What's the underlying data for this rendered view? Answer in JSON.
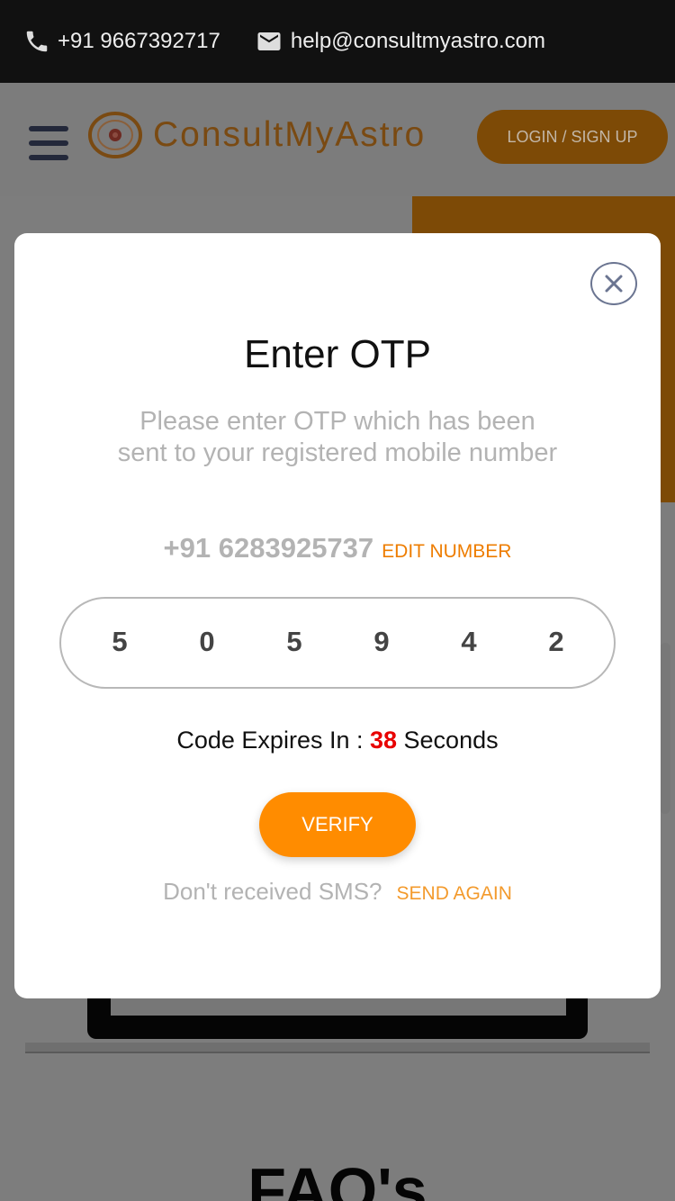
{
  "topbar": {
    "phone": "+91 9667392717",
    "phone_icon": "phone-icon",
    "email": "help@consultmyastro.com",
    "email_icon": "mail-icon"
  },
  "header": {
    "menu_icon": "hamburger-menu-icon",
    "logo_icon": "astro-logo-icon",
    "brand": "ConsultMyAstro",
    "login_label": "LOGIN / SIGN UP"
  },
  "background": {
    "faq_title": "FAQ's"
  },
  "modal": {
    "close_icon": "close-icon",
    "title": "Enter OTP",
    "description": "Please enter OTP which has been sent to your registered mobile number",
    "phone": "+91 6283925737",
    "edit_label": "EDIT NUMBER",
    "otp_digits": [
      "5",
      "0",
      "5",
      "9",
      "4",
      "2"
    ],
    "expire_prefix": "Code Expires In : ",
    "expire_seconds": "38",
    "expire_suffix": " Seconds",
    "verify_label": "VERIFY",
    "resend_text": "Don't received SMS?",
    "resend_label": "SEND AGAIN"
  },
  "colors": {
    "accent": "#ff8c00",
    "link": "#ee7d00",
    "timer": "#e80000",
    "topbar": "#111111"
  }
}
